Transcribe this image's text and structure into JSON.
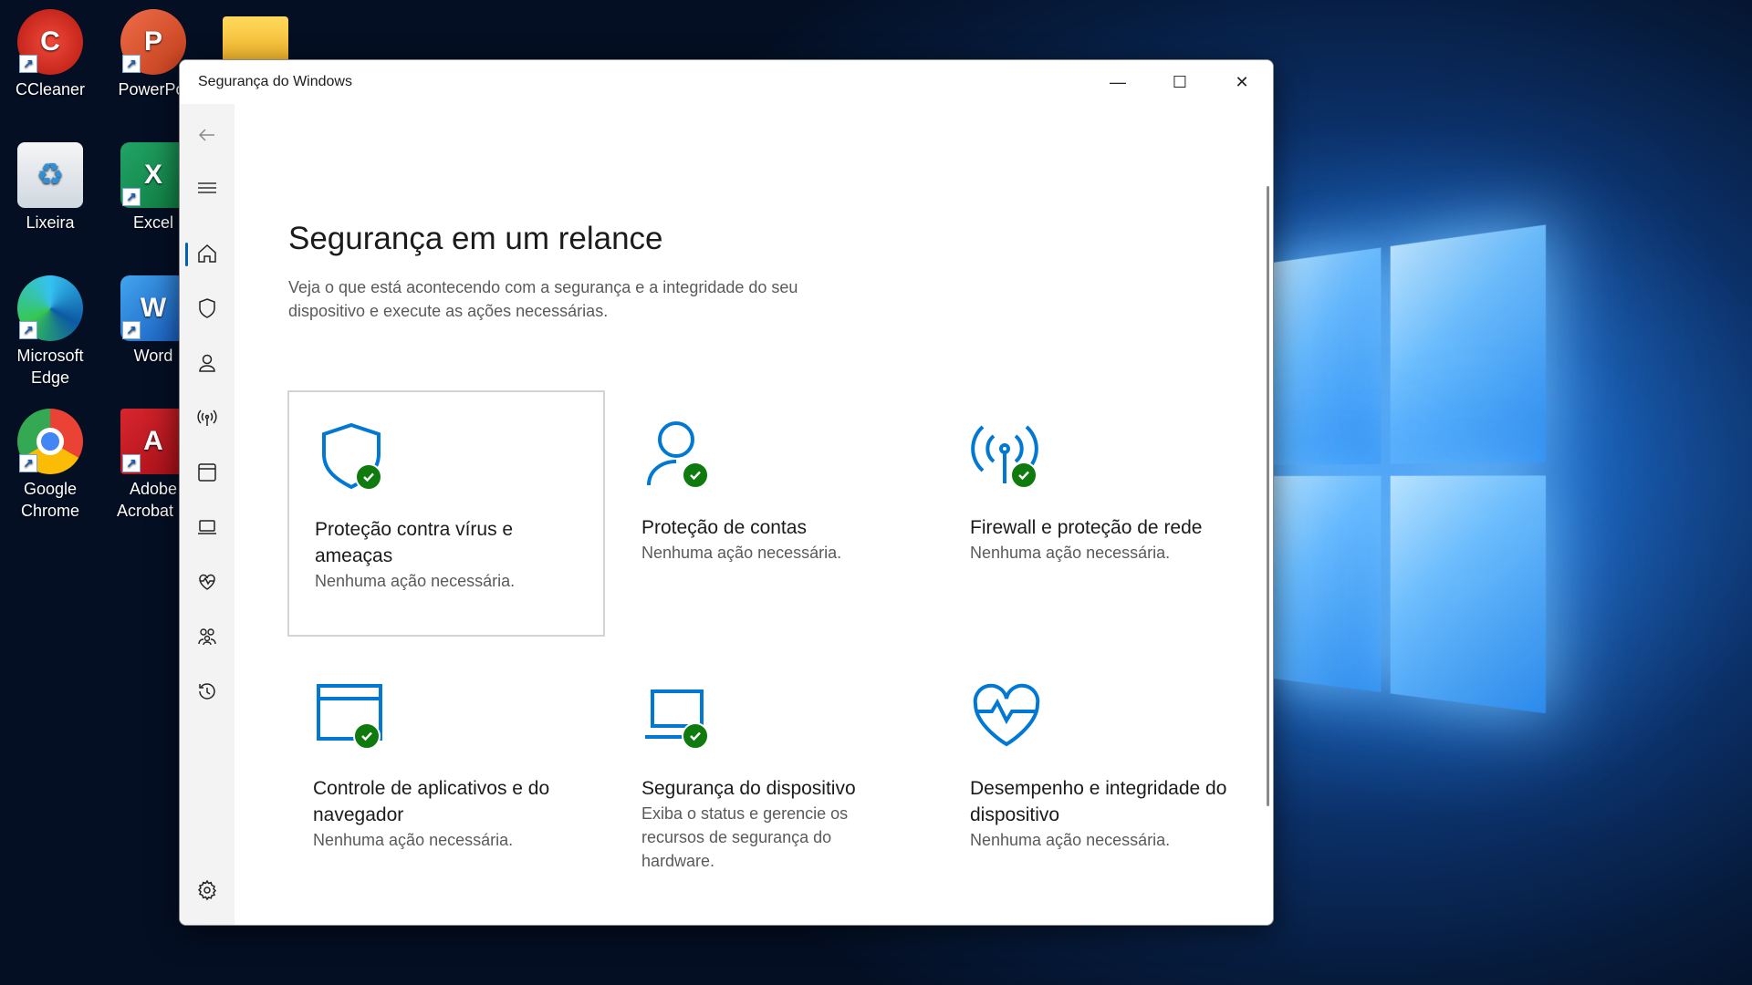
{
  "desktop": {
    "icons": [
      {
        "label": "CCleaner"
      },
      {
        "label": "PowerPoi"
      },
      {
        "label": ""
      },
      {
        "label": "Lixeira"
      },
      {
        "label": "Excel"
      },
      {
        "label": "Microsoft Edge"
      },
      {
        "label": "Word"
      },
      {
        "label": "Google Chrome"
      },
      {
        "label": "Adobe Acrobat D"
      }
    ]
  },
  "window": {
    "title": "Segurança do Windows",
    "controls": {
      "minimize": "—",
      "maximize": "☐",
      "close": "✕"
    }
  },
  "main": {
    "title": "Segurança em um relance",
    "subtitle": "Veja o que está acontecendo com a segurança e a integridade do seu dispositivo e execute as ações necessárias.",
    "cards": [
      {
        "title": "Proteção contra vírus e ameaças",
        "desc": "Nenhuma ação necessária."
      },
      {
        "title": "Proteção de contas",
        "desc": "Nenhuma ação necessária."
      },
      {
        "title": "Firewall e proteção de rede",
        "desc": "Nenhuma ação necessária."
      },
      {
        "title": "Controle de aplicativos e do navegador",
        "desc": "Nenhuma ação necessária."
      },
      {
        "title": "Segurança do dispositivo",
        "desc": "Exiba o status e gerencie os recursos de segurança do hardware."
      },
      {
        "title": "Desempenho e integridade do dispositivo",
        "desc": "Nenhuma ação necessária."
      }
    ]
  },
  "colors": {
    "accent": "#0063b1",
    "ok": "#0f7b0f",
    "icon_blue": "#0078d4"
  }
}
